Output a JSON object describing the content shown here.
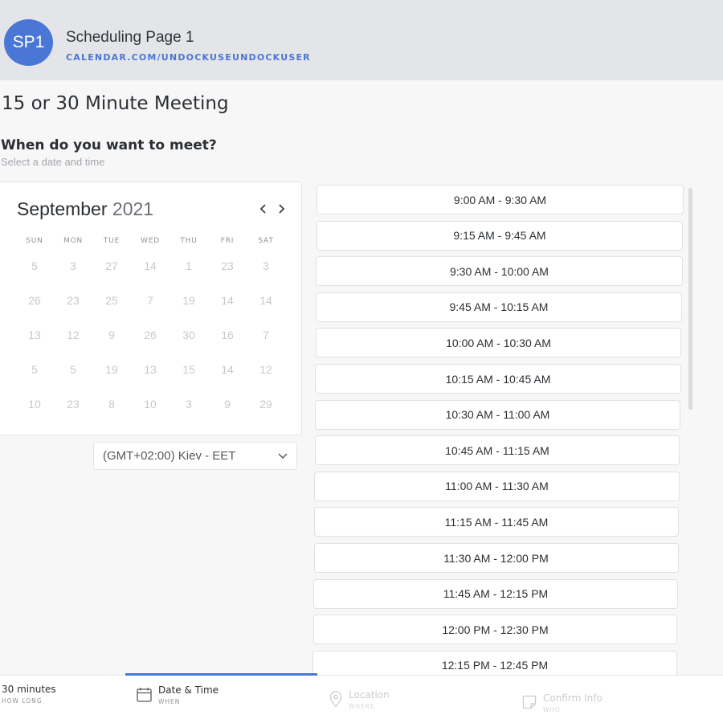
{
  "header": {
    "avatar": "SP1",
    "page_name": "Scheduling Page 1",
    "url": "CALENDAR.COM/UNDOCKUSEUNDOCKUSER"
  },
  "meeting": {
    "title": "15 or 30 Minute Meeting",
    "question": "When do you want to meet?",
    "subtext": "Select a date and time"
  },
  "calendar": {
    "month": "September",
    "year": "2021",
    "prev_icon": "chevron-left-icon",
    "next_icon": "chevron-right-icon",
    "weekdays": [
      "SUN",
      "MON",
      "TUE",
      "WED",
      "THU",
      "FRI",
      "SAT"
    ],
    "weeks": [
      [
        "5",
        "3",
        "27",
        "14",
        "1",
        "23",
        "3"
      ],
      [
        "26",
        "23",
        "25",
        "7",
        "19",
        "14",
        "14"
      ],
      [
        "13",
        "12",
        "9",
        "26",
        "30",
        "16",
        "7"
      ],
      [
        "5",
        "5",
        "19",
        "13",
        "15",
        "14",
        "12"
      ],
      [
        "10",
        "23",
        "8",
        "10",
        "3",
        "9",
        "29"
      ]
    ]
  },
  "timezone": {
    "value": "(GMT+02:00) Kiev - EET",
    "icon": "chevron-down-icon"
  },
  "slots": [
    "9:00 AM - 9:30 AM",
    "9:15 AM - 9:45 AM",
    "9:30 AM - 10:00 AM",
    "9:45 AM - 10:15 AM",
    "10:00 AM - 10:30 AM",
    "10:15 AM - 10:45 AM",
    "10:30 AM - 11:00 AM",
    "10:45 AM - 11:15 AM",
    "11:00 AM - 11:30 AM",
    "11:15 AM - 11:45 AM",
    "11:30 AM - 12:00 PM",
    "11:45 AM - 12:15 PM",
    "12:00 PM - 12:30 PM",
    "12:15 PM - 12:45 PM"
  ],
  "steps": [
    {
      "label": "30 minutes",
      "sub": "HOW LONG",
      "icon": ""
    },
    {
      "label": "Date & Time",
      "sub": "WHEN",
      "icon": "calendar-icon"
    },
    {
      "label": "Location",
      "sub": "WHERE",
      "icon": "location-pin-icon"
    },
    {
      "label": "Confirm Info",
      "sub": "WHO",
      "icon": "note-icon"
    }
  ],
  "colors": {
    "accent": "#4a76d6",
    "header_bg": "#e4e5e9",
    "page_bg": "#f7f7f8"
  }
}
